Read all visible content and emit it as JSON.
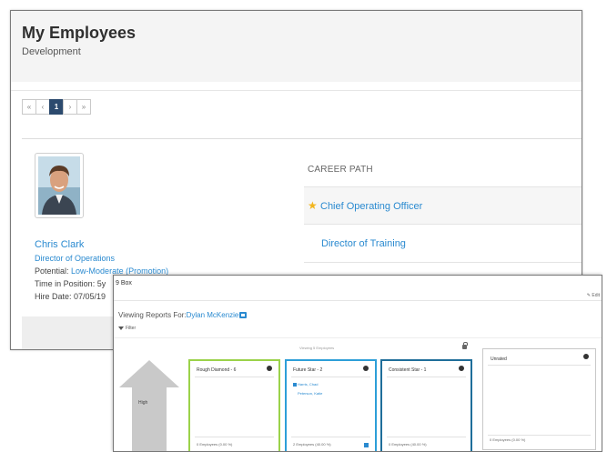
{
  "employees_window": {
    "title": "My Employees",
    "subtitle": "Development",
    "pager": {
      "first": "«",
      "prev": "‹",
      "current": "1",
      "next": "›",
      "last": "»"
    },
    "employee": {
      "name": "Chris Clark",
      "job_title": "Director of Operations",
      "potential_label": "Potential:",
      "potential_value": "Low-Moderate (Promotion)",
      "time_in_position": "Time in Position: 5y",
      "hire_date": "Hire Date: 07/05/19"
    },
    "career_path": {
      "heading": "CAREER PATH",
      "items": [
        "Chief Operating Officer",
        "Director of Training"
      ]
    }
  },
  "nine_box_window": {
    "title": "9 Box",
    "edit_label": "✎ Edit",
    "viewing_for_label": "Viewing Reports For:",
    "viewing_for_person": "Dylan McKenzie",
    "filter_label": "Filter",
    "viewing_count": "Viewing 5 Employees",
    "axis_label": "High",
    "boxes": [
      {
        "title": "Rough Diamond - 6",
        "footer": "0 Employees (0.00 %)",
        "employees": []
      },
      {
        "title": "Future Star - 2",
        "footer": "2 Employees (40.00 %)",
        "employees": [
          "Harris, Chad",
          "Peterson, Katie"
        ]
      },
      {
        "title": "Consistent Star - 1",
        "footer": "0 Employees (40.00 %)",
        "employees": []
      }
    ],
    "unrated": {
      "title": "Unrated",
      "footer": "0 Employees (0.00 %)"
    }
  },
  "colors": {
    "link": "#2a8ad0",
    "rough_diamond": "#9bd24a",
    "future_star": "#2d9fd8",
    "consistent_star": "#1f6e9a",
    "star": "#f2b51d"
  }
}
